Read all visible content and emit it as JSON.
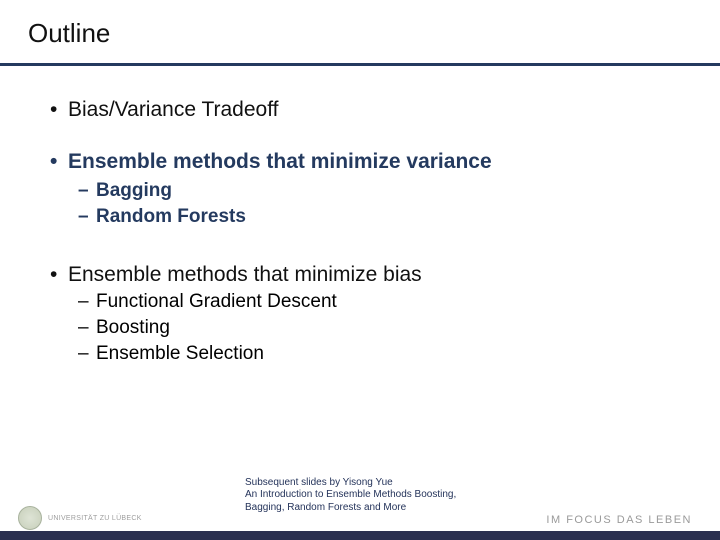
{
  "title": "Outline",
  "items": {
    "i1": "Bias/Variance Tradeoff",
    "i2": "Ensemble methods that minimize variance",
    "i2_sub": {
      "a": "Bagging",
      "b": "Random Forests"
    },
    "i3": "Ensemble methods that minimize bias",
    "i3_sub": {
      "a": "Functional Gradient Descent",
      "b": "Boosting",
      "c": "Ensemble Selection"
    }
  },
  "credit": {
    "line1": "Subsequent slides by Yisong Yue",
    "line2": "An Introduction to Ensemble Methods Boosting,",
    "line3": "Bagging, Random Forests and More"
  },
  "footer": {
    "uni": "UNIVERSITÄT ZU LÜBECK",
    "right": "IM FOCUS DAS LEBEN"
  },
  "glyphs": {
    "bullet": "•",
    "dash": "–"
  }
}
